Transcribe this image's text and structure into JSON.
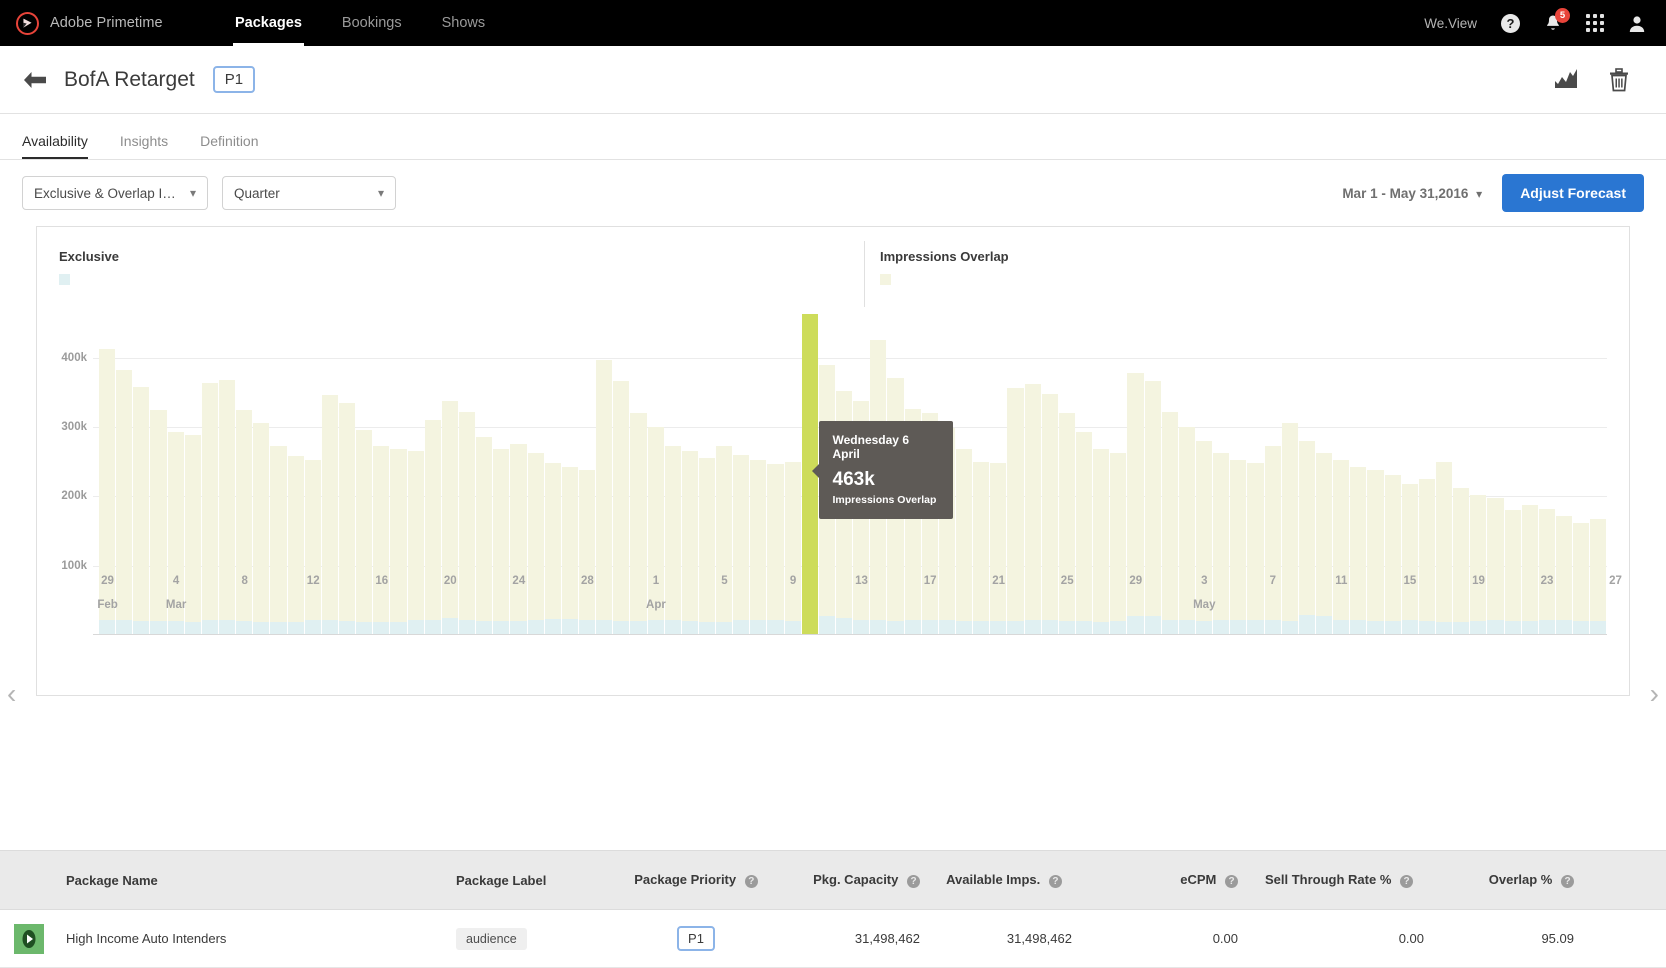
{
  "topnav": {
    "brand": "Adobe Primetime",
    "items": [
      {
        "label": "Packages",
        "active": true
      },
      {
        "label": "Bookings",
        "active": false
      },
      {
        "label": "Shows",
        "active": false
      }
    ],
    "user_label": "We.View",
    "help_glyph": "?",
    "notification_count": "5"
  },
  "header": {
    "title": "BofA Retarget",
    "priority_badge": "P1"
  },
  "tabs": [
    {
      "label": "Availability",
      "active": true
    },
    {
      "label": "Insights",
      "active": false
    },
    {
      "label": "Definition",
      "active": false
    }
  ],
  "filters": {
    "metric_select": "Exclusive & Overlap I…",
    "period_select": "Quarter",
    "chevron": "⌄",
    "date_range": "Mar 1 - May 31,2016",
    "adjust_button": "Adjust Forecast"
  },
  "chart_data": {
    "type": "bar",
    "title": "",
    "xlabel": "",
    "ylabel": "",
    "grid": true,
    "stacked": true,
    "ylim": [
      0,
      470000
    ],
    "yticks": [
      100000,
      200000,
      300000,
      400000
    ],
    "ytick_labels": [
      "100k",
      "200k",
      "300k",
      "400k"
    ],
    "legend_position": "top",
    "series": [
      {
        "name": "Exclusive",
        "color": "#e0f0f2",
        "values": [
          22000,
          21000,
          20000,
          20000,
          20000,
          19000,
          22000,
          22000,
          20000,
          19000,
          19000,
          19000,
          21000,
          21000,
          20000,
          19000,
          19000,
          19000,
          21000,
          22000,
          24000,
          22000,
          20000,
          20000,
          20000,
          22000,
          23000,
          23000,
          22000,
          21000,
          20000,
          20000,
          21000,
          21000,
          20000,
          19000,
          19000,
          21000,
          22000,
          21000,
          20000,
          26000,
          27000,
          25000,
          22000,
          21000,
          20000,
          21000,
          22000,
          21000,
          20000,
          20000,
          20000,
          20000,
          22000,
          21000,
          20000,
          20000,
          19000,
          20000,
          28000,
          27000,
          22000,
          21000,
          20000,
          21000,
          22000,
          22000,
          21000,
          20000,
          29000,
          28000,
          22000,
          21000,
          20000,
          20000,
          21000,
          20000,
          19000,
          19000,
          20000,
          21000,
          20000,
          20000,
          22000,
          21000,
          20000,
          20000
        ]
      },
      {
        "name": "Impressions Overlap",
        "color": "#f4f4e0",
        "highlight_color": "#cddc5a",
        "values": [
          412000,
          382000,
          358000,
          325000,
          292000,
          288000,
          364000,
          367000,
          325000,
          305000,
          272000,
          258000,
          252000,
          346000,
          334000,
          296000,
          272000,
          268000,
          265000,
          310000,
          337000,
          322000,
          286000,
          268000,
          275000,
          262000,
          248000,
          242000,
          238000,
          396000,
          366000,
          320000,
          300000,
          272000,
          265000,
          255000,
          272000,
          260000,
          252000,
          246000,
          250000,
          463000,
          390000,
          352000,
          338000,
          425000,
          370000,
          326000,
          320000,
          298000,
          268000,
          250000,
          248000,
          356000,
          362000,
          348000,
          320000,
          292000,
          268000,
          262000,
          378000,
          366000,
          322000,
          300000,
          280000,
          262000,
          252000,
          248000,
          272000,
          305000,
          280000,
          262000,
          252000,
          242000,
          238000,
          230000,
          218000,
          225000,
          250000,
          212000,
          202000,
          198000,
          180000,
          188000,
          182000,
          172000,
          162000,
          168000
        ]
      }
    ],
    "xticks": [
      {
        "day": "29",
        "month": "Feb"
      },
      {
        "day": "4",
        "month": "Mar"
      },
      {
        "day": "8",
        "month": ""
      },
      {
        "day": "12",
        "month": ""
      },
      {
        "day": "16",
        "month": ""
      },
      {
        "day": "20",
        "month": ""
      },
      {
        "day": "24",
        "month": ""
      },
      {
        "day": "28",
        "month": ""
      },
      {
        "day": "1",
        "month": "Apr"
      },
      {
        "day": "5",
        "month": ""
      },
      {
        "day": "9",
        "month": ""
      },
      {
        "day": "13",
        "month": ""
      },
      {
        "day": "17",
        "month": ""
      },
      {
        "day": "21",
        "month": ""
      },
      {
        "day": "25",
        "month": ""
      },
      {
        "day": "29",
        "month": ""
      },
      {
        "day": "3",
        "month": "May"
      },
      {
        "day": "7",
        "month": ""
      },
      {
        "day": "11",
        "month": ""
      },
      {
        "day": "15",
        "month": ""
      },
      {
        "day": "19",
        "month": ""
      },
      {
        "day": "23",
        "month": ""
      },
      {
        "day": "27",
        "month": ""
      }
    ],
    "highlight_index": 41,
    "tooltip": {
      "date": "Wednesday 6 April",
      "value": "463k",
      "series": "Impressions Overlap"
    }
  },
  "chart_nav": {
    "prev": "‹",
    "next": "›"
  },
  "table": {
    "headers": {
      "package_name": "Package Name",
      "package_label": "Package Label",
      "package_priority": "Package Priority",
      "pkg_capacity": "Pkg. Capacity",
      "available_imps": "Available Imps.",
      "ecpm": "eCPM",
      "sell_through": "Sell Through Rate %",
      "overlap": "Overlap %"
    },
    "rows": [
      {
        "name": "High Income Auto Intenders",
        "label": "audience",
        "priority": "P1",
        "capacity": "31,498,462",
        "available": "31,498,462",
        "ecpm": "0.00",
        "sell_through": "0.00",
        "overlap": "95.09"
      }
    ]
  }
}
